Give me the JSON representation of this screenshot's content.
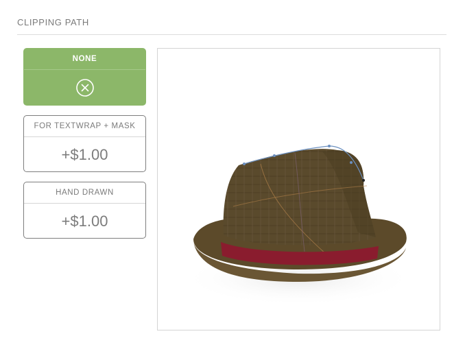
{
  "section": {
    "title": "CLIPPING PATH"
  },
  "options": [
    {
      "label": "NONE",
      "icon": "close-circle-icon",
      "selected": true
    },
    {
      "label": "FOR TEXTWRAP + MASK",
      "price": "+$1.00",
      "selected": false
    },
    {
      "label": "HAND DRAWN",
      "price": "+$1.00",
      "selected": false
    }
  ],
  "colors": {
    "selected_green": "#8cb769",
    "border_gray": "#7d7d7d",
    "text_gray": "#7a7a7a",
    "hat_brown": "#5a4a2c",
    "hat_band": "#8a1c2e"
  },
  "preview": {
    "image": "brown tweed fedora hat with red band and blue clipping path points"
  }
}
